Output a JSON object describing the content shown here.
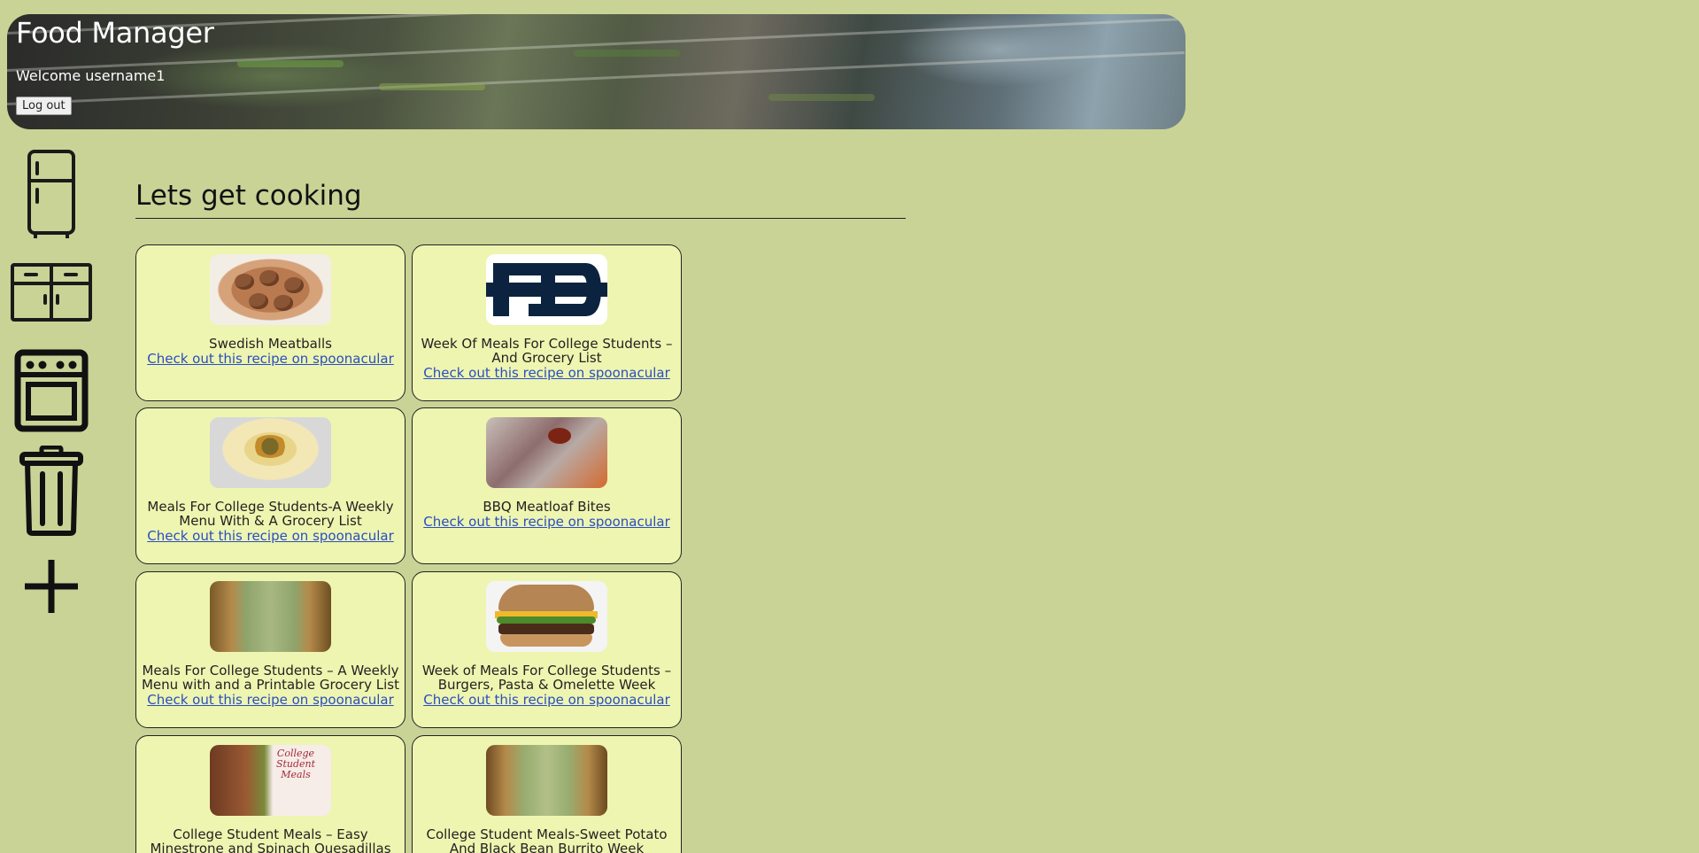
{
  "header": {
    "title": "Food Manager",
    "welcome": "Welcome username1",
    "logout_label": "Log out"
  },
  "sidebar": {
    "items": [
      {
        "name": "fridge",
        "icon": "fridge-icon"
      },
      {
        "name": "pantry",
        "icon": "cabinet-icon"
      },
      {
        "name": "oven",
        "icon": "oven-icon"
      },
      {
        "name": "trash",
        "icon": "trash-icon"
      },
      {
        "name": "add",
        "icon": "plus-icon"
      }
    ]
  },
  "main": {
    "section_title": "Lets get cooking",
    "link_text": "Check out this recipe on spoonacular",
    "recipes": [
      {
        "title": "Swedish Meatballs",
        "image": "swedish-meatballs-photo"
      },
      {
        "title": "Week Of Meals For College Students – And Grocery List",
        "image": "notre-dame-logo"
      },
      {
        "title": "Meals For College Students-A Weekly Menu With & A Grocery List",
        "image": "quesadilla-photo"
      },
      {
        "title": "BBQ Meatloaf Bites",
        "image": "meatloaf-bites-photo"
      },
      {
        "title": "Meals For College Students – A Weekly Menu with and a Printable Grocery List",
        "image": "spinach-wraps-photo"
      },
      {
        "title": "Week of Meals For College Students – Burgers, Pasta & Omelette Week",
        "image": "burger-photo"
      },
      {
        "title": "College Student Meals – Easy Minestrone and Spinach Quesadillas Week",
        "image": "minestrone-collage-photo",
        "image_text": "College Student Meals"
      },
      {
        "title": "College Student Meals-Sweet Potato And Black Bean Burrito Week",
        "image": "burrito-photo"
      }
    ]
  },
  "colors": {
    "page_background": "#c9d396",
    "card_background": "#eef5b0",
    "link": "#2a4ec2",
    "notre_dame_navy": "#0c2340"
  }
}
